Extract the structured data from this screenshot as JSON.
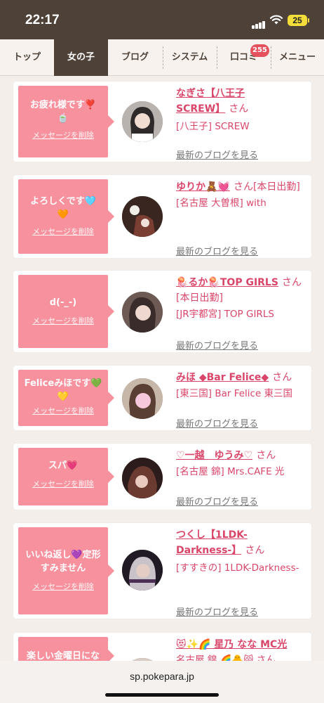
{
  "status": {
    "time": "22:17",
    "battery": "25"
  },
  "nav": {
    "tabs": [
      {
        "label": "トップ"
      },
      {
        "label": "女の子"
      },
      {
        "label": "ブログ"
      },
      {
        "label": "システム"
      },
      {
        "label": "口コミ"
      },
      {
        "label": "メニュー"
      }
    ],
    "active_tab": "女の子",
    "review_badge": "255"
  },
  "cards": [
    {
      "message_lines": [
        "お疲れ様です❣️",
        "🍵"
      ],
      "delete_label": "メッセージを削除",
      "name_lines": [
        "なぎさ【八王子",
        "SCREW】"
      ],
      "san": "さん",
      "shop": "[八王子] SCREW",
      "blog_link": "最新のブログを見る"
    },
    {
      "message_lines": [
        "よろしくです🩵",
        "🧡"
      ],
      "delete_label": "メッセージを削除",
      "name_lines": [
        "ゆりか🧸💓"
      ],
      "san": "さん[本日出勤]",
      "shop": "[名古屋 大曽根] with",
      "blog_link": "最新のブログを見る"
    },
    {
      "message_lines": [
        "d(-_-)"
      ],
      "delete_label": "メッセージを削除",
      "name_lines": [
        "🪼るか🪼TOP GIRLS"
      ],
      "san": "さん[本日出勤]",
      "shop": "[JR宇都宮] TOP GIRLS",
      "blog_link": "最新のブログを見る"
    },
    {
      "message_lines": [
        "Feliceみほです💚",
        "💛"
      ],
      "delete_label": "メッセージを削除",
      "name_lines": [
        "みほ ◆Bar Felice◆"
      ],
      "san": "さん",
      "shop": "[東三国] Bar Felice 東三国",
      "blog_link": "最新のブログを見る"
    },
    {
      "message_lines": [
        "スパ💗"
      ],
      "delete_label": "メッセージを削除",
      "name_lines": [
        "♡一越　ゆうみ♡"
      ],
      "san": "さん",
      "shop": "[名古屋 錦] Mrs.CAFE 光",
      "blog_link": "最新のブログを見る"
    },
    {
      "message_lines": [
        "いいね返し💜定形",
        "すみません"
      ],
      "delete_label": "メッセージを削除",
      "name_lines": [
        "つくし【1LDK-",
        "Darkness-】"
      ],
      "san": "さん",
      "shop": "[すすきの] 1LDK-Darkness-",
      "blog_link": "最新のブログを見る"
    },
    {
      "message_lines": [
        "楽しい金曜日にな"
      ],
      "delete_label": "",
      "name_lines": [
        "😻✨🌈 星乃 なな MC光"
      ],
      "san": "",
      "shop": "名古屋 錦 🌈🐥😸 さん",
      "blog_link": ""
    }
  ],
  "url": "sp.pokepara.jp",
  "colors": {
    "header": "#4e4238",
    "bubble": "#f7919e",
    "accent": "#d9466a"
  }
}
